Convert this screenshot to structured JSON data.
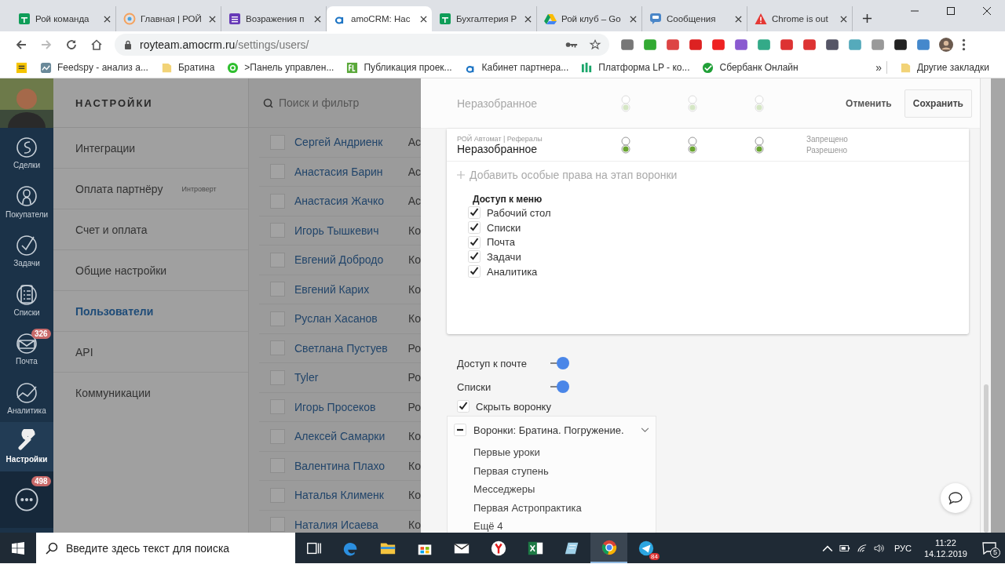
{
  "browser": {
    "tabs": [
      {
        "title": "Рой команда",
        "kind": "sheet",
        "selected": false
      },
      {
        "title": "Главная | РОЙ",
        "kind": "target",
        "selected": false
      },
      {
        "title": "Возражения п",
        "kind": "form",
        "selected": false
      },
      {
        "title": "amoCRM: Нас",
        "kind": "amo",
        "selected": true
      },
      {
        "title": "Бухгалтерия Р",
        "kind": "sheet",
        "selected": false
      },
      {
        "title": "Рой клуб – Go",
        "kind": "drive",
        "selected": false
      },
      {
        "title": "Сообщения",
        "kind": "chat",
        "selected": false
      },
      {
        "title": "Chrome is out",
        "kind": "warning",
        "selected": false
      }
    ],
    "address": {
      "domain": "royteam.amocrm.ru",
      "path": "/settings/users/"
    },
    "bookmarks": [
      {
        "label": "Feedspy - анализ а...",
        "kind": "chart"
      },
      {
        "label": "Братина",
        "kind": "folder"
      },
      {
        "label": ">Панель управлен...",
        "kind": "on"
      },
      {
        "label": "Публикация проек...",
        "kind": "fl"
      },
      {
        "label": "Кабинет партнера...",
        "kind": "amo"
      },
      {
        "label": "Платформа LP - ко...",
        "kind": "bars"
      },
      {
        "label": "Сбербанк Онлайн",
        "kind": "sber"
      }
    ],
    "more_bookmarks": "»",
    "other_bookmarks": "Другие закладки"
  },
  "nav": {
    "items": [
      {
        "label": "Сделки",
        "kind": "deals",
        "selected": false
      },
      {
        "label": "Покупатели",
        "kind": "buyers",
        "selected": false
      },
      {
        "label": "Задачи",
        "kind": "tasks",
        "selected": false
      },
      {
        "label": "Списки",
        "kind": "lists",
        "selected": false
      },
      {
        "label": "Почта",
        "kind": "mail",
        "badge": "326",
        "selected": false
      },
      {
        "label": "Аналитика",
        "kind": "analytics",
        "selected": false
      },
      {
        "label": "Настройки",
        "kind": "settings",
        "selected": true
      }
    ],
    "chat_badge": "498"
  },
  "settings": {
    "title": "НАСТРОЙКИ",
    "items": [
      {
        "label": "Интеграции",
        "selected": false
      },
      {
        "label": "Оплата партнёру",
        "note": "Интроверт",
        "selected": false
      },
      {
        "label": "Счет и оплата",
        "selected": false
      },
      {
        "label": "Общие настройки",
        "selected": false
      },
      {
        "label": "Пользователи",
        "selected": true
      },
      {
        "label": "API",
        "selected": false
      },
      {
        "label": "Коммуникации",
        "selected": false
      }
    ]
  },
  "users": {
    "search_placeholder": "Поиск и фильтр",
    "rows": [
      {
        "name": "Сергей Андриенк",
        "column_2": "Ас",
        "checked": false
      },
      {
        "name": "Анастасия Барин",
        "column_2": "Ас",
        "checked": false
      },
      {
        "name": "Анастасия Жачко",
        "column_2": "Ас",
        "checked": false
      },
      {
        "name": "Игорь Тышкевич",
        "column_2": "Ко",
        "checked": false
      },
      {
        "name": "Евгений Добродо",
        "column_2": "Ко",
        "checked": false
      },
      {
        "name": "Евгений Карих",
        "column_2": "Ко",
        "checked": false
      },
      {
        "name": "Руслан Хасанов",
        "column_2": "Ко",
        "checked": false
      },
      {
        "name": "Светлана Пустуев",
        "column_2": "Ро",
        "checked": false
      },
      {
        "name": "Tyler",
        "column_2": "Ро",
        "checked": false
      },
      {
        "name": "Игорь Просеков",
        "column_2": "Ро",
        "checked": false
      },
      {
        "name": "Алексей Самарки",
        "column_2": "Ко",
        "checked": false
      },
      {
        "name": "Валентина Плахо",
        "column_2": "Ко",
        "checked": false
      },
      {
        "name": "Наталья Клименк",
        "column_2": "Ко",
        "checked": false
      },
      {
        "name": "Наталия Исаева",
        "column_2": "Ко",
        "checked": false
      }
    ]
  },
  "modal": {
    "cancel": "Отменить",
    "save": "Сохранить",
    "stages": [
      {
        "stage": "Неразобранное",
        "faded": true
      },
      {
        "group": "РОЙ Автомат | Рефералы",
        "stage": "Неразобранное",
        "denied": "Запрещено",
        "allowed": "Разрешено",
        "faded": false
      }
    ],
    "add_rights": "Добавить особые права на этап воронки",
    "menu_access": {
      "title": "Доступ к меню",
      "items": [
        {
          "label": "Рабочий стол",
          "checked": true
        },
        {
          "label": "Списки",
          "checked": true
        },
        {
          "label": "Почта",
          "checked": true
        },
        {
          "label": "Задачи",
          "checked": true
        },
        {
          "label": "Аналитика",
          "checked": true
        }
      ]
    },
    "toggles": [
      {
        "label": "Доступ к почте",
        "on": true
      },
      {
        "label": "Списки",
        "on": true
      }
    ],
    "hide_funnel": {
      "label": "Скрыть воронку",
      "checked": true
    },
    "funnels": {
      "title": "Воронки: Братина. Погружение.",
      "expanded": true,
      "items": [
        "Первые уроки",
        "Первая ступень",
        "Месседжеры",
        "Первая Астропрактика"
      ],
      "more": "Ещё 4"
    }
  },
  "taskbar": {
    "search_placeholder": "Введите здесь текст для поиска",
    "apps": [
      {
        "kind": "taskview",
        "selected": false
      },
      {
        "kind": "edge",
        "selected": false
      },
      {
        "kind": "explorer",
        "selected": false
      },
      {
        "kind": "store",
        "selected": false
      },
      {
        "kind": "mail",
        "selected": false
      },
      {
        "kind": "yandex",
        "selected": false
      },
      {
        "kind": "excel",
        "selected": false
      },
      {
        "kind": "notes",
        "selected": false
      },
      {
        "kind": "chrome",
        "selected": true
      },
      {
        "kind": "telegram",
        "badge": "84",
        "selected": false
      }
    ],
    "language": "РУС",
    "time": "11:22",
    "date": "14.12.2019",
    "notifications": "5"
  }
}
